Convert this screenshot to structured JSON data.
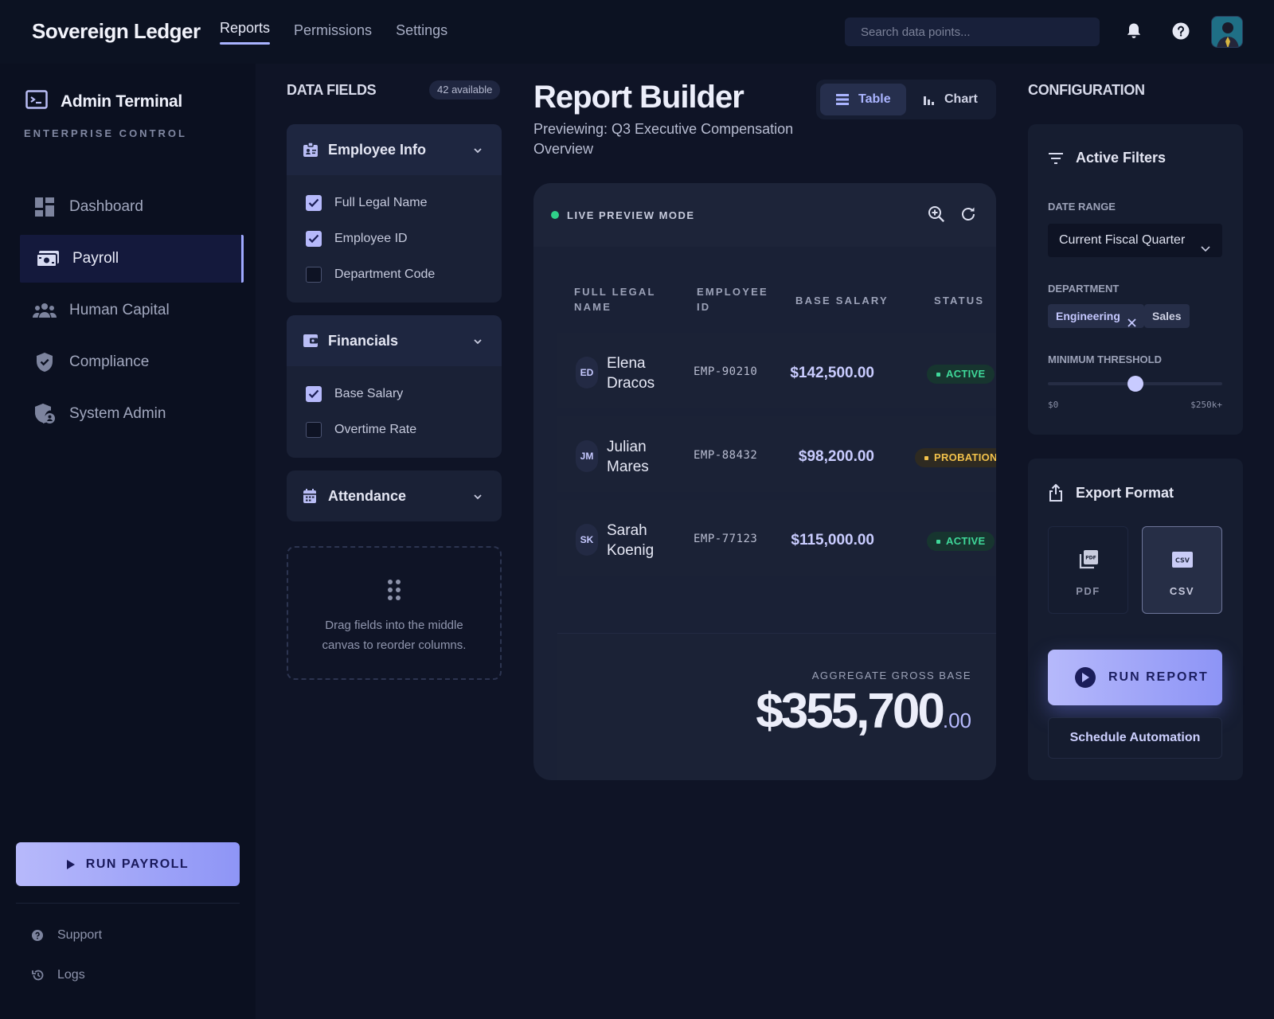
{
  "app": {
    "brand": "Sovereign Ledger",
    "nav": [
      {
        "label": "Reports",
        "active": true
      },
      {
        "label": "Permissions",
        "active": false
      },
      {
        "label": "Settings",
        "active": false
      }
    ],
    "search_placeholder": "Search data points...",
    "icons": [
      "bell-icon",
      "help-icon",
      "user-avatar"
    ]
  },
  "sidebar": {
    "title": "Admin Terminal",
    "subtitle": "ENTERPRISE CONTROL",
    "items": [
      {
        "label": "Dashboard",
        "icon": "dashboard-icon",
        "active": false
      },
      {
        "label": "Payroll",
        "icon": "payments-icon",
        "active": true
      },
      {
        "label": "Human Capital",
        "icon": "groups-icon",
        "active": false
      },
      {
        "label": "Compliance",
        "icon": "shield-icon",
        "active": false
      },
      {
        "label": "System Admin",
        "icon": "admin-shield-icon",
        "active": false
      }
    ],
    "run_button": "RUN PAYROLL",
    "footer": [
      {
        "label": "Support",
        "icon": "help-circle-icon"
      },
      {
        "label": "Logs",
        "icon": "history-icon"
      }
    ]
  },
  "data_fields": {
    "title": "DATA FIELDS",
    "count_badge": "42 available",
    "groups": [
      {
        "label": "Employee Info",
        "icon": "badge-icon",
        "expanded": true,
        "fields": [
          {
            "label": "Full Legal Name",
            "checked": true
          },
          {
            "label": "Employee ID",
            "checked": true
          },
          {
            "label": "Department Code",
            "checked": false
          }
        ]
      },
      {
        "label": "Financials",
        "icon": "wallet-icon",
        "expanded": true,
        "fields": [
          {
            "label": "Base Salary",
            "checked": true
          },
          {
            "label": "Overtime Rate",
            "checked": false
          }
        ]
      },
      {
        "label": "Attendance",
        "icon": "calendar-icon",
        "expanded": false,
        "fields": []
      }
    ],
    "dropzone_text": "Drag fields into the middle canvas to reorder columns."
  },
  "report": {
    "title": "Report Builder",
    "subtitle": "Previewing: Q3 Executive Compensation Overview",
    "view_toggle": [
      {
        "label": "Table",
        "icon": "table-icon",
        "active": true
      },
      {
        "label": "Chart",
        "icon": "bar-chart-icon",
        "active": false
      }
    ],
    "live_label": "LIVE PREVIEW MODE",
    "columns": [
      {
        "line1": "FULL LEGAL",
        "line2": "NAME"
      },
      {
        "line1": "EMPLOYEE",
        "line2": "ID"
      },
      {
        "line1": "BASE SALARY",
        "line2": ""
      },
      {
        "line1": "STATUS",
        "line2": ""
      }
    ],
    "rows": [
      {
        "initials": "ED",
        "first": "Elena",
        "last": "Dracos",
        "id": "EMP-90210",
        "salary": "$142,500.00",
        "status": "ACTIVE",
        "status_kind": "active"
      },
      {
        "initials": "JM",
        "first": "Julian",
        "last": "Mares",
        "id": "EMP-88432",
        "salary": "$98,200.00",
        "status": "PROBATION",
        "status_kind": "probation"
      },
      {
        "initials": "SK",
        "first": "Sarah",
        "last": "Koenig",
        "id": "EMP-77123",
        "salary": "$115,000.00",
        "status": "ACTIVE",
        "status_kind": "active"
      }
    ],
    "aggregate_label": "AGGREGATE GROSS BASE",
    "aggregate_whole": "$355,700",
    "aggregate_cents": ".00"
  },
  "config": {
    "title": "CONFIGURATION",
    "filters": {
      "title": "Active Filters",
      "date_label": "DATE RANGE",
      "date_value": "Current Fiscal Quarter",
      "dept_label": "DEPARTMENT",
      "dept_tags": [
        {
          "label": "Engineering",
          "selected": true
        },
        {
          "label": "Sales",
          "selected": false
        }
      ],
      "threshold_label": "MINIMUM THRESHOLD",
      "threshold_min": "$0",
      "threshold_max": "$250k+",
      "threshold_fraction": 0.5
    },
    "export": {
      "title": "Export Format",
      "formats": [
        {
          "label": "PDF",
          "icon": "pdf-icon",
          "selected": false
        },
        {
          "label": "CSV",
          "icon": "csv-icon",
          "selected": true
        }
      ],
      "run_button": "RUN REPORT",
      "schedule_button": "Schedule Automation"
    }
  },
  "colors": {
    "accent": "#b6b9fb",
    "active_status": "#3fd99a",
    "probation_status": "#f2c14b",
    "background": "#0f1426"
  }
}
